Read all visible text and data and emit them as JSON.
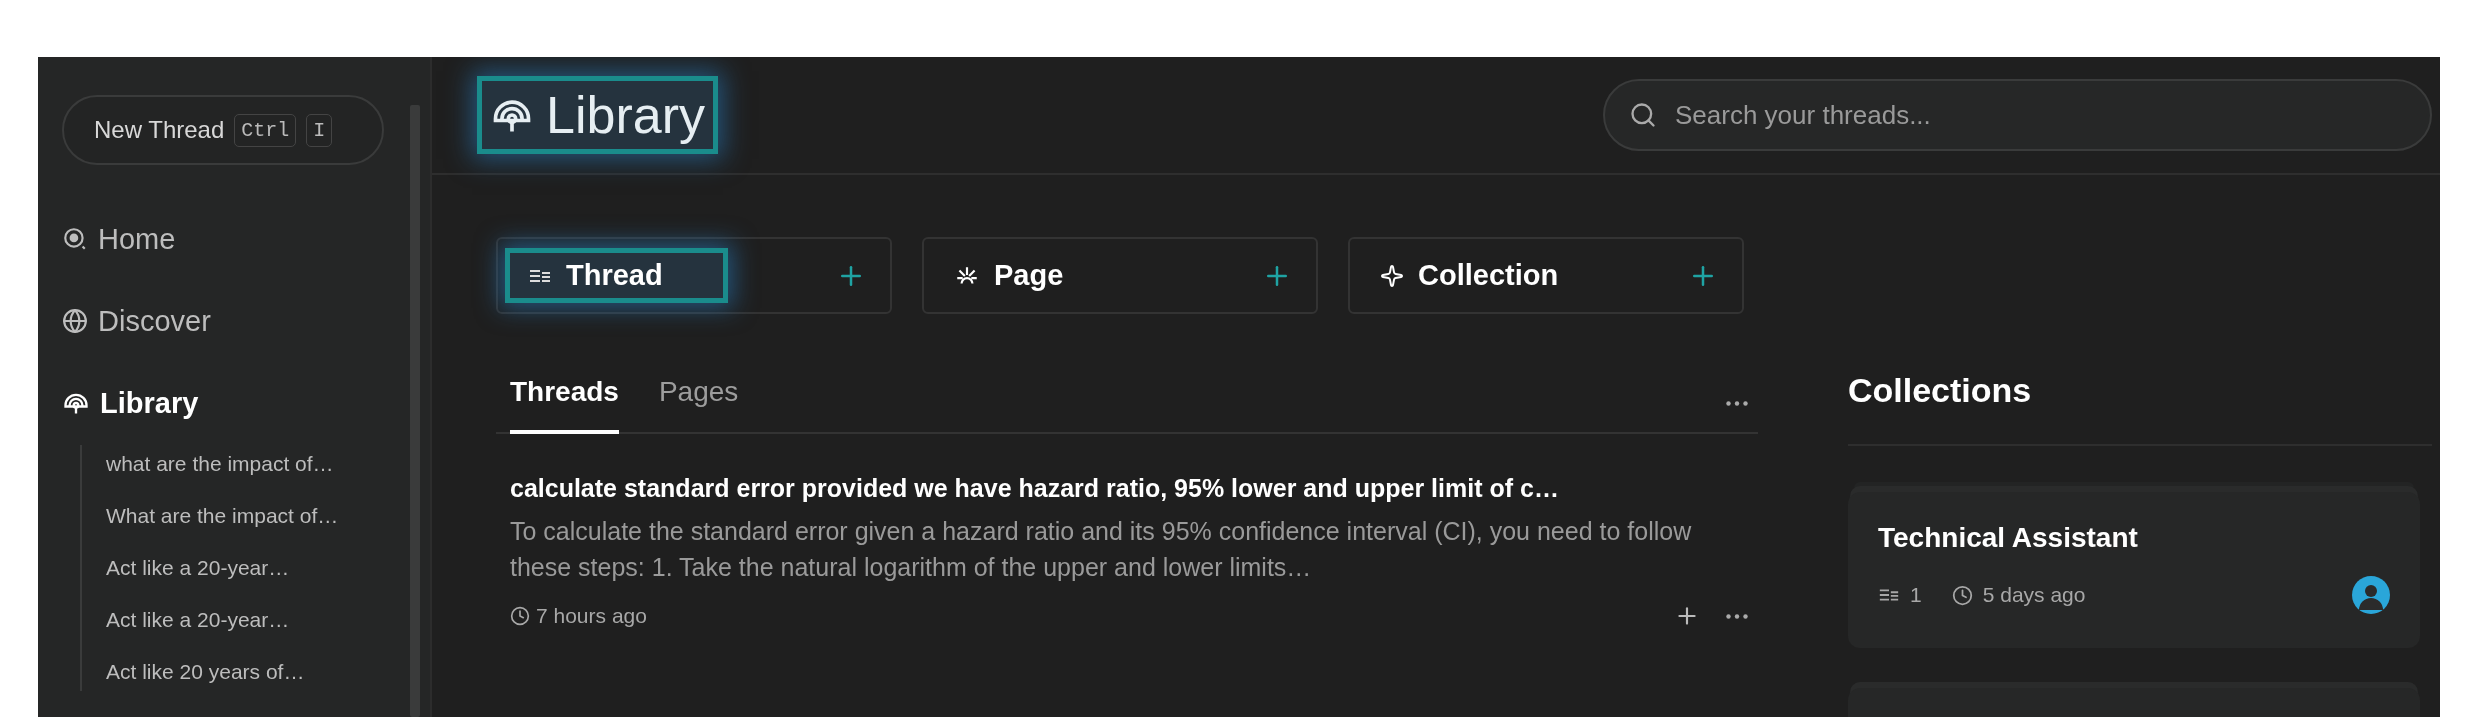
{
  "sidebar": {
    "new_thread": {
      "label": "New Thread",
      "keys": [
        "Ctrl",
        "I"
      ]
    },
    "nav": [
      {
        "label": "Home",
        "selected": false
      },
      {
        "label": "Discover",
        "selected": false
      },
      {
        "label": "Library",
        "selected": true
      }
    ],
    "library_items": [
      "what are the impact of…",
      "What are the impact of…",
      "Act like a 20-year…",
      "Act like a 20-year…",
      "Act like 20 years of…"
    ]
  },
  "header": {
    "title": {
      "text": "Library",
      "highlighted": true
    },
    "search": {
      "placeholder": "Search your threads..."
    }
  },
  "create_buttons": [
    {
      "label": "Thread",
      "highlighted": true
    },
    {
      "label": "Page",
      "highlighted": false
    },
    {
      "label": "Collection",
      "highlighted": false
    }
  ],
  "tabs": [
    {
      "label": "Threads",
      "selected": true
    },
    {
      "label": "Pages",
      "selected": false
    }
  ],
  "threads": [
    {
      "title": "calculate standard error provided we have hazard ratio, 95% lower and upper limit of c…",
      "snippet": "To calculate the standard error given a hazard ratio and its 95% confidence interval (CI), you need to follow these steps: 1. Take the natural logarithm of the upper and lower limits…",
      "time": "7 hours ago"
    }
  ],
  "collections": {
    "heading": "Collections",
    "items": [
      {
        "title": "Technical Assistant",
        "count": "1",
        "time": "5 days ago"
      }
    ]
  }
}
